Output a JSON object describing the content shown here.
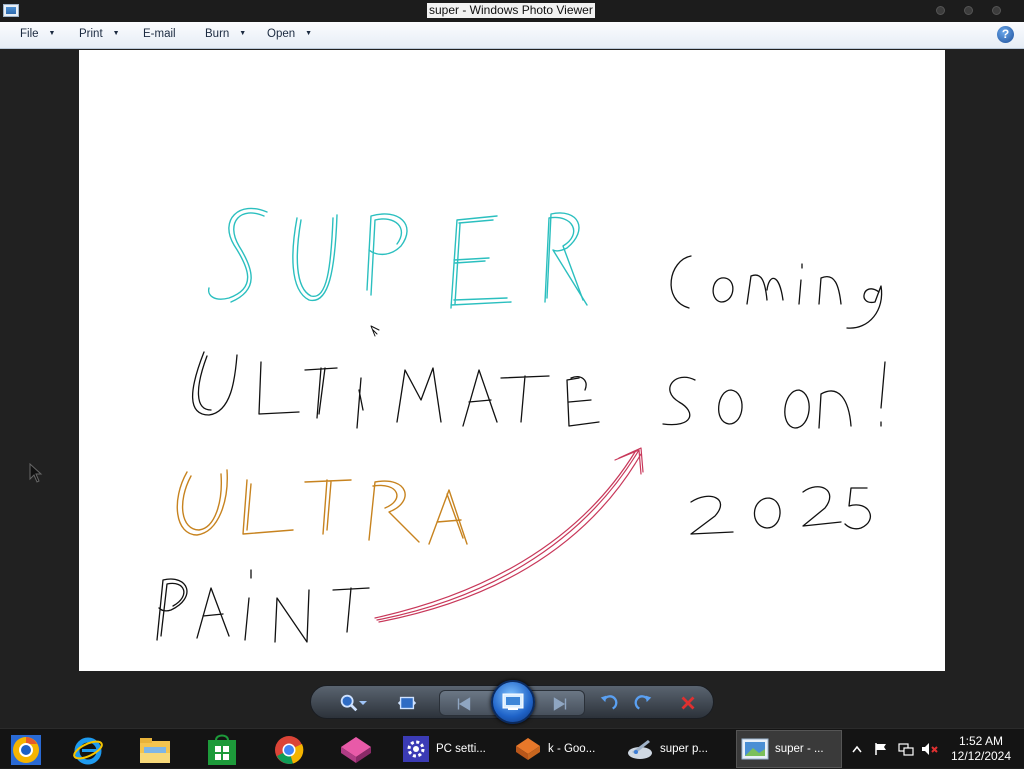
{
  "window": {
    "title": "super - Windows Photo Viewer"
  },
  "menu": {
    "items": [
      {
        "label": "File",
        "has_dropdown": true
      },
      {
        "label": "Print",
        "has_dropdown": true
      },
      {
        "label": "E-mail",
        "has_dropdown": false
      },
      {
        "label": "Burn",
        "has_dropdown": true
      },
      {
        "label": "Open",
        "has_dropdown": true
      }
    ],
    "help_label": "?"
  },
  "image": {
    "handwritten_text": [
      "SUPER",
      "ULTIMATE",
      "ULTRA",
      "PAINT",
      "Coming",
      "soon!",
      "2025"
    ],
    "colors": {
      "super": "#2bbfbf",
      "ultra": "#c7831f",
      "arrow": "#c8385a",
      "ink": "#111111"
    }
  },
  "controls": {
    "zoom": "magnifier-icon",
    "actual_size": "actual-size-icon",
    "previous": "previous-icon",
    "slideshow": "slideshow-icon",
    "next": "next-icon",
    "rotate_ccw": "rotate-counterclockwise-icon",
    "rotate_cw": "rotate-clockwise-icon",
    "delete": "delete-icon"
  },
  "taskbar": {
    "pinned": [
      "chrome-canary-icon",
      "internet-explorer-icon",
      "file-explorer-icon",
      "store-icon",
      "chrome-icon",
      "paint-app-icon"
    ],
    "tasks": [
      {
        "label": "PC setti...",
        "icon": "gear-icon",
        "active": false
      },
      {
        "label": "k - Goo...",
        "icon": "firefox-icon",
        "active": false
      },
      {
        "label": "super p...",
        "icon": "paint-icon",
        "active": false
      },
      {
        "label": "super - ...",
        "icon": "photo-viewer-icon",
        "active": true
      }
    ],
    "tray": [
      "show-hidden-icons",
      "flag-icon",
      "network-icon",
      "volume-muted-icon"
    ],
    "time": "1:52 AM",
    "date": "12/12/2024"
  }
}
